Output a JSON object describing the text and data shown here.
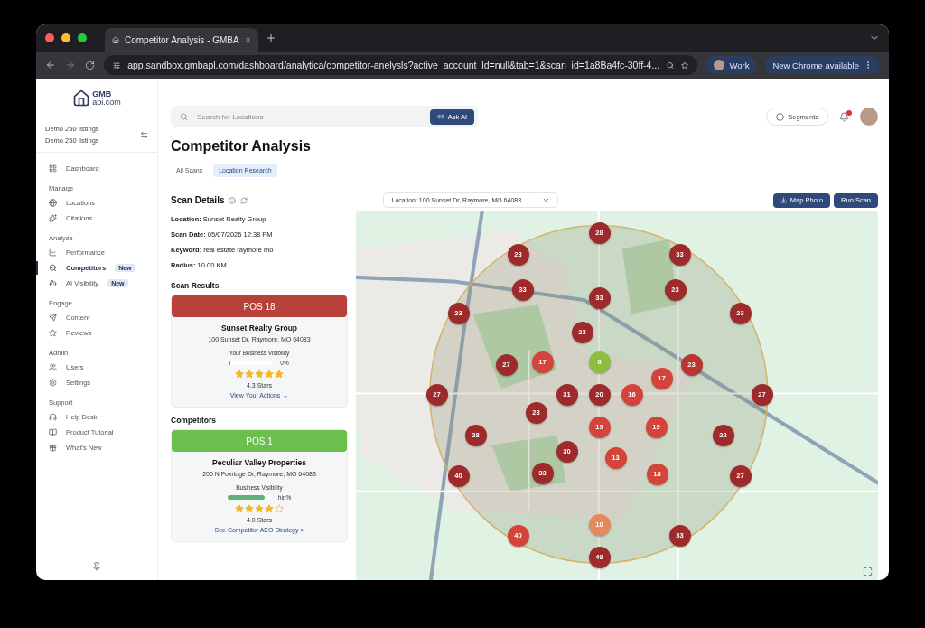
{
  "browser": {
    "tab_title": "Competitor Analysis - GMBA",
    "url": "app.sandbox.gmbapl.com/dashboard/analytica/competitor-anelysls?active_account_ld=null&tab=1&scan_id=1a8Ba4fc-30ff-4...",
    "profile": "Work",
    "update": "New Chrome available"
  },
  "sidebar": {
    "logo": {
      "line1": "GMB",
      "line2": "api.com"
    },
    "accounts": [
      "Demo 250 listings",
      "Demo 250 listings"
    ],
    "sections": [
      {
        "items": [
          {
            "label": "Dashboard",
            "selected": false
          }
        ]
      },
      {
        "heading": "Manage",
        "items": [
          {
            "label": "Locations",
            "selected": false
          },
          {
            "label": "Citations",
            "selected": false
          }
        ]
      },
      {
        "heading": "Analyze",
        "items": [
          {
            "label": "Performance",
            "selected": false
          },
          {
            "label": "Competitors",
            "selected": true,
            "badge": "New"
          },
          {
            "label": "AI Visibility",
            "selected": false,
            "badge": "New"
          }
        ]
      },
      {
        "heading": "Engage",
        "items": [
          {
            "label": "Content",
            "selected": false
          },
          {
            "label": "Reviews",
            "selected": false
          }
        ]
      },
      {
        "heading": "Admin",
        "items": [
          {
            "label": "Users",
            "selected": false
          },
          {
            "label": "Settings",
            "selected": false
          }
        ]
      },
      {
        "heading": "Support",
        "items": [
          {
            "label": "Help Desk",
            "selected": false
          },
          {
            "label": "Product Tutorial",
            "selected": false
          },
          {
            "label": "What's New",
            "selected": false
          }
        ]
      }
    ]
  },
  "topbar": {
    "search": {
      "placeholder": "Search for Locations"
    },
    "ask_ai": "Ask AI",
    "segments": "Segments"
  },
  "page_title": "Competitor Analysis",
  "tabs": [
    {
      "label": "All Scans",
      "selected": false
    },
    {
      "label": "Location Research",
      "selected": true
    }
  ],
  "scan_details": {
    "title": "Scan Details",
    "fields": [
      {
        "label": "Location:",
        "value": "Sunset Realty Group"
      },
      {
        "label": "Scan Date:",
        "value": "05/07/2026 12:38 PM"
      },
      {
        "label": "Keyword:",
        "value": "real estate raymore mo"
      },
      {
        "label": "Radius:",
        "value": "10.00 KM"
      }
    ]
  },
  "location_select": "Location: 100 Sunset Dr, Raymore, MO 64083",
  "actions": [
    "Map Photo",
    "Run Scan"
  ],
  "results_heading": "Scan Results",
  "result": {
    "position": "POS 18",
    "color": "#b8413a",
    "name": "Sunset Realty Group",
    "address": "100 Sunset Dr, Raymore, MO 64083",
    "visibility_label": "Your Business Visibility",
    "level": 0.01,
    "reading": "0%",
    "stars": 5,
    "rating": "4.3 Stars",
    "link": "View Your Actions →"
  },
  "competitors_heading": "Competitors",
  "competitors": [
    {
      "position": "POS 1",
      "color": "#6cbf4f",
      "name": "Peculiar Valley Properties",
      "address": "200 N Foxridge Dr, Raymore, MO 64083",
      "visibility_label": "Business Visibility",
      "level": 0.85,
      "reading": "hig%",
      "stars": 4,
      "rating": "4.0 Stars",
      "link": "See Competitor AEO Strategy >"
    }
  ],
  "map_pins": [
    {
      "label": "28",
      "color": "#9e2a2b"
    },
    {
      "label": "23",
      "color": "#9e2a2b"
    },
    {
      "label": "33",
      "color": "#9e2a2b"
    },
    {
      "label": "33",
      "color": "#9e2a2b"
    },
    {
      "label": "33",
      "color": "#9e2a2b"
    },
    {
      "label": "23",
      "color": "#9e2a2b"
    },
    {
      "label": "23",
      "color": "#9e2a2b"
    },
    {
      "label": "23",
      "color": "#9e2a2b"
    },
    {
      "label": "23",
      "color": "#9e2a2b"
    },
    {
      "label": "27",
      "color": "#9e2a2b"
    },
    {
      "label": "17",
      "color": "#d4443a"
    },
    {
      "label": "6",
      "color": "#8cbf3f"
    },
    {
      "label": "23",
      "color": "#b83530"
    },
    {
      "label": "17",
      "color": "#d4443a"
    },
    {
      "label": "27",
      "color": "#9e2a2b"
    },
    {
      "label": "31",
      "color": "#9e2a2b"
    },
    {
      "label": "20",
      "color": "#9e2a2b"
    },
    {
      "label": "16",
      "color": "#d4443a"
    },
    {
      "label": "27",
      "color": "#9e2a2b"
    },
    {
      "label": "23",
      "color": "#9e2a2b"
    },
    {
      "label": "19",
      "color": "#d4443a"
    },
    {
      "label": "19",
      "color": "#d4443a"
    },
    {
      "label": "28",
      "color": "#9e2a2b"
    },
    {
      "label": "22",
      "color": "#9e2a2b"
    },
    {
      "label": "30",
      "color": "#9e2a2b"
    },
    {
      "label": "13",
      "color": "#d4443a"
    },
    {
      "label": "40",
      "color": "#9e2a2b"
    },
    {
      "label": "33",
      "color": "#9e2a2b"
    },
    {
      "label": "18",
      "color": "#d4443a"
    },
    {
      "label": "27",
      "color": "#9e2a2b"
    },
    {
      "label": "10",
      "color": "#e8875a"
    },
    {
      "label": "40",
      "color": "#d4443a"
    },
    {
      "label": "33",
      "color": "#9e2a2b"
    },
    {
      "label": "49",
      "color": "#9e2a2b"
    }
  ]
}
